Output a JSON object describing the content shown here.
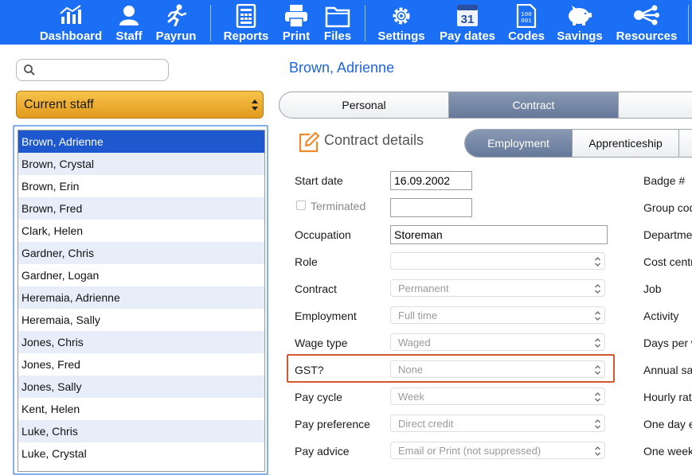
{
  "toolbar": {
    "items": [
      {
        "label": "Dashboard",
        "icon": "dashboard-icon"
      },
      {
        "label": "Staff",
        "icon": "staff-icon"
      },
      {
        "label": "Payrun",
        "icon": "payrun-icon"
      },
      {
        "label": "Reports",
        "icon": "reports-icon"
      },
      {
        "label": "Print",
        "icon": "print-icon"
      },
      {
        "label": "Files",
        "icon": "files-icon"
      },
      {
        "label": "Settings",
        "icon": "settings-icon"
      },
      {
        "label": "Pay dates",
        "icon": "calendar-icon",
        "calendar_day": "31"
      },
      {
        "label": "Codes",
        "icon": "codes-icon",
        "codes_glyph": "100\n001"
      },
      {
        "label": "Savings",
        "icon": "piggy-bank-icon"
      },
      {
        "label": "Resources",
        "icon": "resources-icon"
      }
    ],
    "color": "#1b6ff5"
  },
  "search": {
    "value": "",
    "placeholder": ""
  },
  "staff_filter": {
    "selected": "Current staff"
  },
  "staff_list": [
    "Brown, Adrienne",
    "Brown, Crystal",
    "Brown, Erin",
    "Brown, Fred",
    "Clark, Helen",
    "Gardner, Chris",
    "Gardner, Logan",
    "Heremaia, Adrienne",
    "Heremaia, Sally",
    "Jones, Chris",
    "Jones, Fred",
    "Jones, Sally",
    "Kent, Helen",
    "Luke, Chris",
    "Luke, Crystal"
  ],
  "selected_staff": "Brown, Adrienne",
  "employee_name": "Brown, Adrienne",
  "main_tabs": [
    "Personal",
    "Contract"
  ],
  "active_main_tab": "Contract",
  "section_title": "Contract details",
  "sub_tabs": [
    "Employment",
    "Apprenticeship"
  ],
  "active_sub_tab": "Employment",
  "form": {
    "start_date": {
      "label": "Start date",
      "value": "16.09.2002"
    },
    "terminated": {
      "label": "Terminated",
      "value": "",
      "checked": false
    },
    "occupation": {
      "label": "Occupation",
      "value": "Storeman"
    },
    "role": {
      "label": "Role",
      "value": ""
    },
    "contract": {
      "label": "Contract",
      "value": "Permanent"
    },
    "employment": {
      "label": "Employment",
      "value": "Full time"
    },
    "wage_type": {
      "label": "Wage type",
      "value": "Waged"
    },
    "gst": {
      "label": "GST?",
      "value": "None"
    },
    "pay_cycle": {
      "label": "Pay cycle",
      "value": "Week"
    },
    "pay_preference": {
      "label": "Pay preference",
      "value": "Direct credit"
    },
    "pay_advice": {
      "label": "Pay advice",
      "value": "Email or Print (not suppressed)"
    }
  },
  "right_labels": [
    "Badge #",
    "Group cod",
    "Departme",
    "Cost centr",
    "Job",
    "Activity",
    "Days per w",
    "Annual sa",
    "Hourly rat",
    "One day e",
    "One week"
  ],
  "highlight_color": "#d4582f"
}
